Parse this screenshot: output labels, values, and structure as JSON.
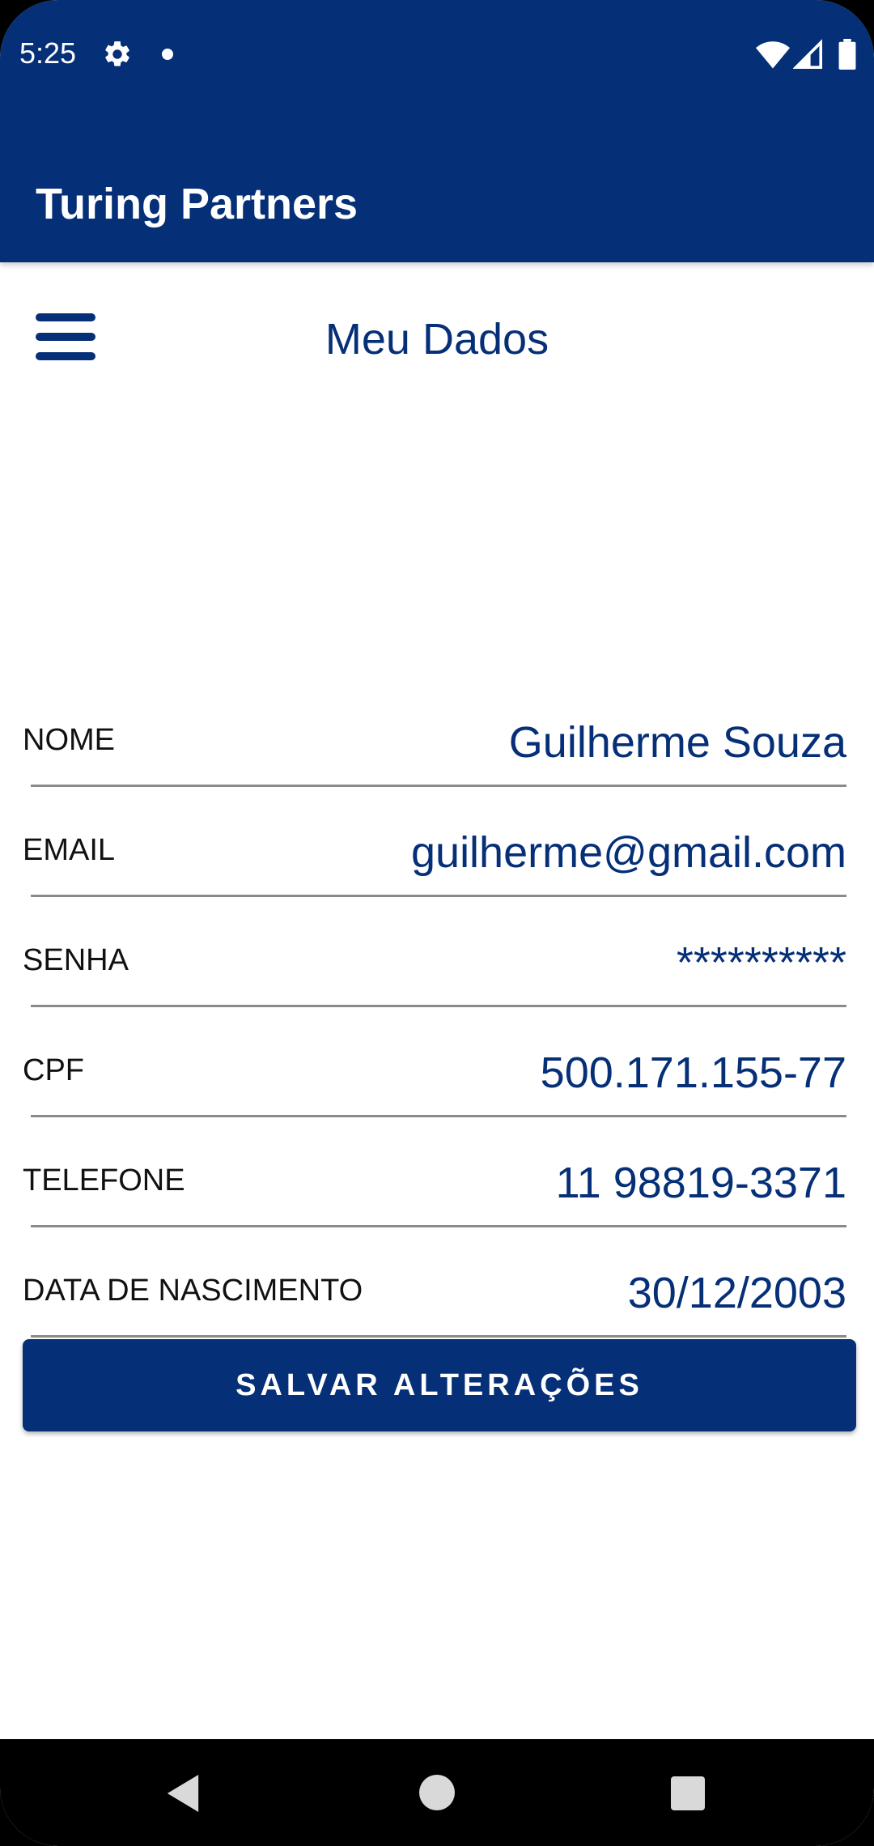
{
  "status_bar": {
    "time": "5:25",
    "icons": [
      "gear-icon",
      "notification-dot",
      "wifi-icon",
      "signal-icon",
      "battery-icon"
    ]
  },
  "app_bar": {
    "title": "Turing Partners",
    "background_color": "#052f77"
  },
  "header": {
    "menu_icon": "hamburger-menu-icon",
    "title": "Meu Dados"
  },
  "form": {
    "fields": [
      {
        "label": "NOME",
        "value": "Guilherme Souza"
      },
      {
        "label": "EMAIL",
        "value": "guilherme@gmail.com"
      },
      {
        "label": "SENHA",
        "value": "**********"
      },
      {
        "label": "CPF",
        "value": "500.171.155-77"
      },
      {
        "label": "TELEFONE",
        "value": "11 98819-3371"
      },
      {
        "label": "DATA DE NASCIMENTO",
        "value": "30/12/2003"
      }
    ]
  },
  "actions": {
    "save_label": "SALVAR ALTERAÇÕES"
  },
  "nav_bar": {
    "icons": [
      "back-icon",
      "home-icon",
      "recents-icon"
    ]
  },
  "colors": {
    "brand": "#052f77",
    "divider": "#8a8a8a",
    "label_text": "#111111"
  }
}
